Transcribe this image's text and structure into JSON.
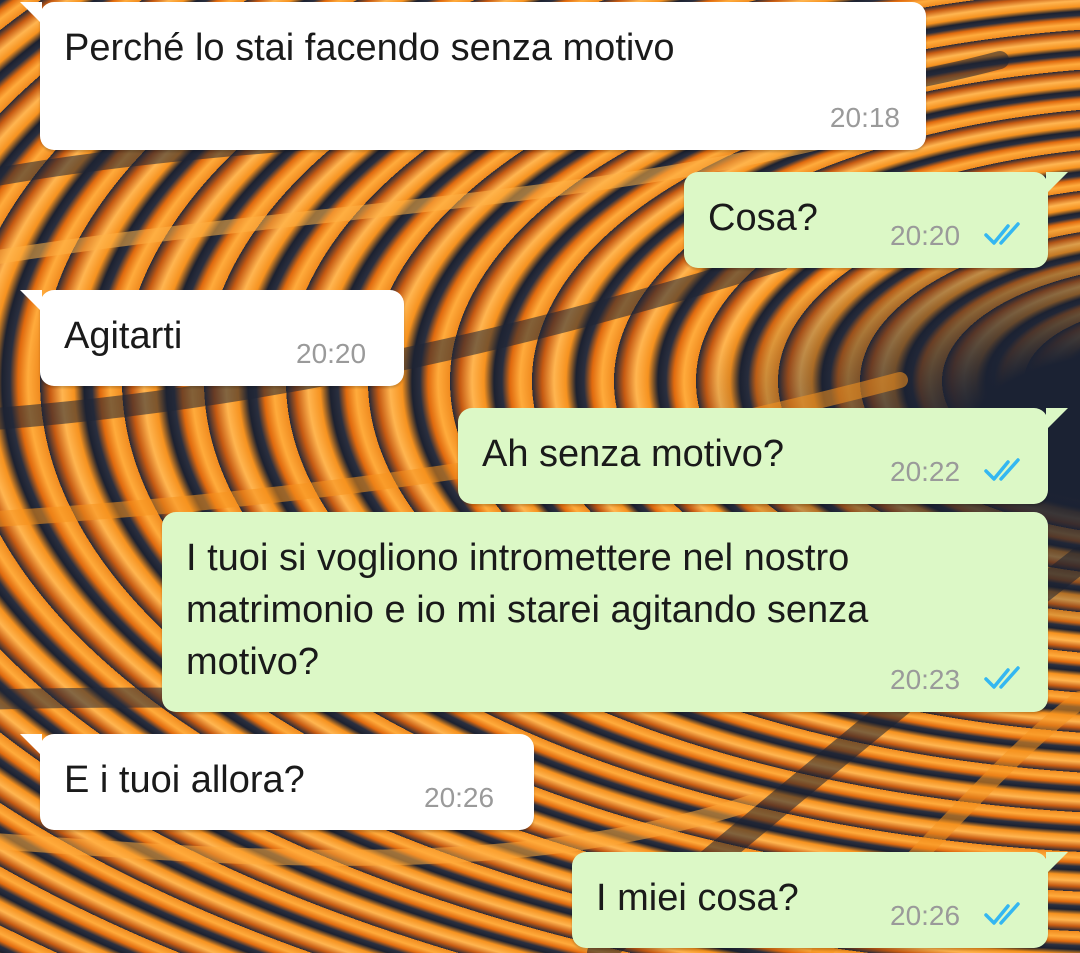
{
  "colors": {
    "incoming_bubble": "#ffffff",
    "outgoing_bubble": "#dcf8c6",
    "read_ticks": "#34b7f1",
    "timestamp": "#9a9a9a"
  },
  "messages": [
    {
      "direction": "incoming",
      "text": "Perché lo stai facendo senza motivo",
      "time": "20:18"
    },
    {
      "direction": "outgoing",
      "text": "Cosa?",
      "time": "20:20",
      "status": "read",
      "status_icon": "double-check-icon"
    },
    {
      "direction": "incoming",
      "text": "Agitarti",
      "time": "20:20"
    },
    {
      "direction": "outgoing",
      "text": "Ah senza motivo?",
      "time": "20:22",
      "status": "read",
      "status_icon": "double-check-icon"
    },
    {
      "direction": "outgoing",
      "text": "I tuoi si vogliono intromettere nel nostro matrimonio e io mi starei agitando senza motivo?",
      "time": "20:23",
      "status": "read",
      "status_icon": "double-check-icon"
    },
    {
      "direction": "incoming",
      "text": "E i tuoi allora?",
      "time": "20:26"
    },
    {
      "direction": "outgoing",
      "text": "I miei cosa?",
      "time": "20:26",
      "status": "read",
      "status_icon": "double-check-icon"
    }
  ]
}
